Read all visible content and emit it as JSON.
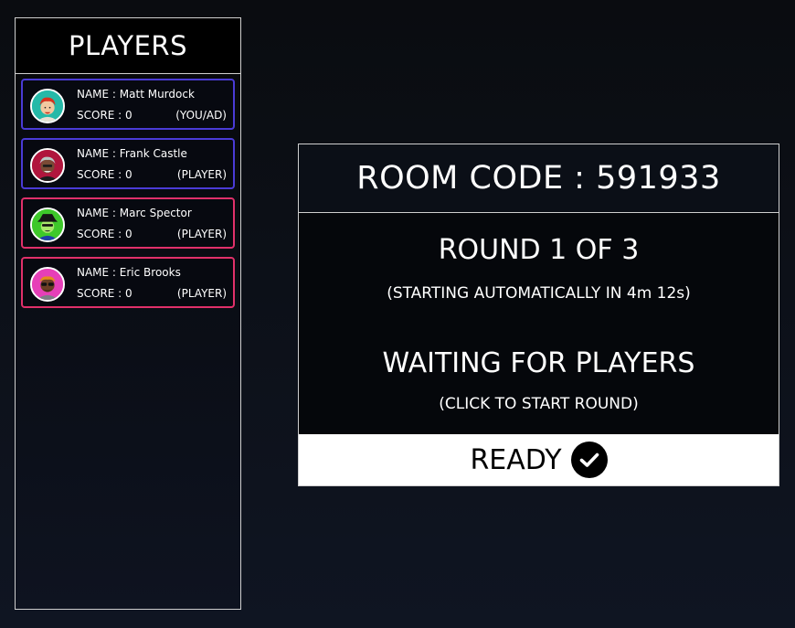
{
  "sidebar": {
    "title": "PLAYERS",
    "players": [
      {
        "name": "NAME : Matt Murdock",
        "score": "SCORE : 0",
        "role": "(YOU/AD)",
        "border_color": "#4a3bd6",
        "avatar": "avatar-red-hair-icon"
      },
      {
        "name": "NAME : Frank Castle",
        "score": "SCORE : 0",
        "role": "(PLAYER)",
        "border_color": "#4a3bd6",
        "avatar": "avatar-grey-hair-icon"
      },
      {
        "name": "NAME : Marc Spector",
        "score": "SCORE : 0",
        "role": "(PLAYER)",
        "border_color": "#e0306a",
        "avatar": "avatar-hat-icon"
      },
      {
        "name": "NAME : Eric Brooks",
        "score": "SCORE : 0",
        "role": "(PLAYER)",
        "border_color": "#e0306a",
        "avatar": "avatar-sunglasses-icon"
      }
    ]
  },
  "room": {
    "code_text": "ROOM CODE : 591933",
    "round_title": "ROUND 1 OF 3",
    "round_sub": "(STARTING AUTOMATICALLY IN 4m 12s)",
    "waiting_title": "WAITING FOR PLAYERS",
    "waiting_sub": "(CLICK TO START ROUND)",
    "ready_label": "READY",
    "ready_icon": "check-circle-icon"
  },
  "colors": {
    "background": "#0a0c10",
    "panel_border": "#cfcfcf",
    "host_border": "#4a3bd6",
    "player_border": "#e0306a",
    "ready_bg": "#ffffff"
  }
}
